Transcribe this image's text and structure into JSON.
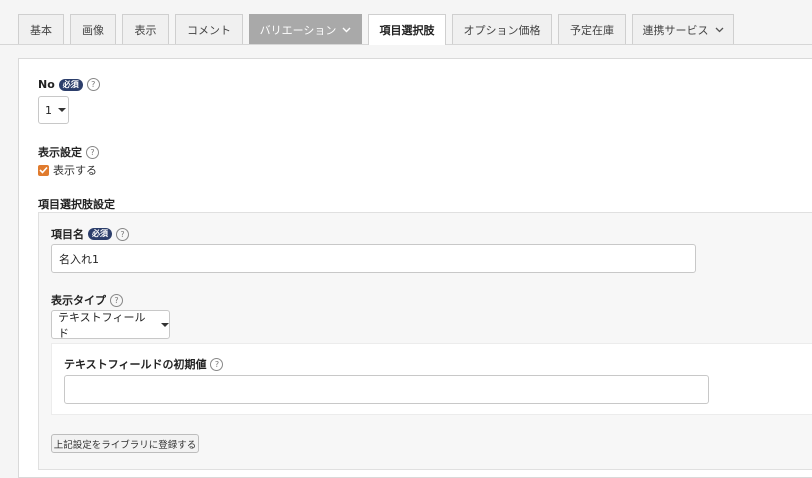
{
  "tabs": [
    {
      "label": "基本"
    },
    {
      "label": "画像"
    },
    {
      "label": "表示"
    },
    {
      "label": "コメント"
    },
    {
      "label": "バリエーション"
    },
    {
      "label": "項目選択肢"
    },
    {
      "label": "オプション価格"
    },
    {
      "label": "予定在庫"
    },
    {
      "label": "連携サービス"
    }
  ],
  "required_badge": "必須",
  "help_glyph": "?",
  "no_field": {
    "label": "No",
    "value": "1"
  },
  "display_setting": {
    "label": "表示設定",
    "checkbox_label": "表示する",
    "checked": true
  },
  "option_settings": {
    "section_label": "項目選択肢設定",
    "item_name_label": "項目名",
    "item_name_value": "名入れ1",
    "display_type_label": "表示タイプ",
    "display_type_value": "テキストフィールド",
    "initial_value_label": "テキストフィールドの初期値",
    "initial_value": "",
    "register_button": "上記設定をライブラリに登録する"
  },
  "colors": {
    "accent": "#e07b2e",
    "badge": "#2c3e6b",
    "tab_dark": "#a9a9a9"
  }
}
